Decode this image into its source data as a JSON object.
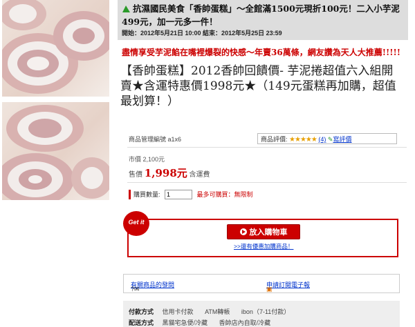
{
  "promo": {
    "title": "抗濕國民美食「香帥蛋糕」～全館滿1500元現折100元！二入小芋泥499元，加一元多一件！",
    "dates": "開始：2012年5月21日 10:00 結束：2012年5月25日 23:59"
  },
  "tagline": "盡情享受芋泥餡在嘴裡爆裂的快感～年賣36萬條，網友讚為天人大推薦!!!!!",
  "product_name": "【香帥蛋糕】2012香帥回饋價- 芋泥捲超值六入組開賣★含運特惠價1998元★（149元蛋糕再加購，超值最划算！）",
  "meta": {
    "code_label": "商品管理編號 a1x6"
  },
  "rating": {
    "label": "商品評價:",
    "stars": "★★★★★",
    "count": "(4)",
    "write": "寫評價"
  },
  "price": {
    "market": "市價 2,100元",
    "sale_label": "售價",
    "sale_amount": "1,998元",
    "shipping": "含運費"
  },
  "qty": {
    "label": "購買數量",
    "value": "1",
    "limit": "最多可購買：無限制"
  },
  "cart": {
    "badge": "Get it",
    "button": "放入購物車",
    "addon": ">>還有優惠加購商品！"
  },
  "info": {
    "questions": "有關商品的發問",
    "subscribe": "申請訂閱電子報"
  },
  "payment": {
    "pay_label": "付款方式",
    "pay_methods": [
      "信用卡付款",
      "ATM轉帳",
      "ibon（7-11付款）"
    ],
    "ship_label": "配送方式",
    "ship_methods": [
      "黑貓宅急便/冷藏",
      "香帥店內自取/冷藏"
    ]
  }
}
